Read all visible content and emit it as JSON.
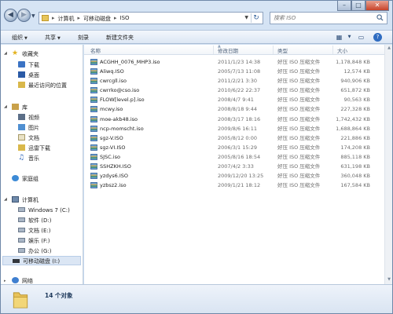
{
  "address": {
    "crumbs": [
      "计算机",
      "可移动磁盘",
      "ISO"
    ]
  },
  "search": {
    "placeholder": "搜索 ISO"
  },
  "toolbar": {
    "organize": "组织",
    "share": "共享",
    "burn": "刻录",
    "new_folder": "新建文件夹"
  },
  "sidebar": {
    "favorites": "收藏夹",
    "fav_items": [
      "下载",
      "桌面",
      "最近访问的位置"
    ],
    "libraries": "库",
    "lib_items": [
      "视频",
      "图片",
      "文档",
      "迅雷下载",
      "音乐"
    ],
    "homegroup": "家庭组",
    "computer": "计算机",
    "drives": [
      "Windows 7 (C:)",
      "软件 (D:)",
      "文档 (E:)",
      "娱乐 (F:)",
      "办公 (G:)",
      "可移动磁盘 (I:)"
    ],
    "network": "网络"
  },
  "columns": {
    "name": "名称",
    "date": "修改日期",
    "type": "类型",
    "size": "大小"
  },
  "files": [
    {
      "name": "ACGHH_0076_MHP3.iso",
      "date": "2011/1/23 14:38",
      "type": "好压 ISO 压缩文件",
      "size": "1,178,848 KB"
    },
    {
      "name": "Aliwq.ISO",
      "date": "2005/7/13 11:08",
      "type": "好压 ISO 压缩文件",
      "size": "12,574 KB"
    },
    {
      "name": "cwrcgll.iso",
      "date": "2011/2/21 3:30",
      "type": "好压 ISO 压缩文件",
      "size": "940,906 KB"
    },
    {
      "name": "cwrrko@cso.iso",
      "date": "2010/6/22 22:37",
      "type": "好压 ISO 压缩文件",
      "size": "651,872 KB"
    },
    {
      "name": "FLOW[level.p].iso",
      "date": "2008/4/7 9:41",
      "type": "好压 ISO 压缩文件",
      "size": "90,563 KB"
    },
    {
      "name": "mcwy.iso",
      "date": "2008/8/18 9:44",
      "type": "好压 ISO 压缩文件",
      "size": "227,328 KB"
    },
    {
      "name": "moe-akb48.iso",
      "date": "2008/3/17 18:16",
      "type": "好压 ISO 压缩文件",
      "size": "1,742,432 KB"
    },
    {
      "name": "ncp-momscht.iso",
      "date": "2009/8/6 16:11",
      "type": "好压 ISO 压缩文件",
      "size": "1,688,864 KB"
    },
    {
      "name": "sgz-V.ISO",
      "date": "2005/8/12 0:00",
      "type": "好压 ISO 压缩文件",
      "size": "221,886 KB"
    },
    {
      "name": "sgz-VI.ISO",
      "date": "2006/3/1 15:29",
      "type": "好压 ISO 压缩文件",
      "size": "174,208 KB"
    },
    {
      "name": "SJSC.iso",
      "date": "2005/8/16 18:54",
      "type": "好压 ISO 压缩文件",
      "size": "885,118 KB"
    },
    {
      "name": "SSHZKH.ISO",
      "date": "2007/4/2 3:33",
      "type": "好压 ISO 压缩文件",
      "size": "631,198 KB"
    },
    {
      "name": "yzdys6.ISO",
      "date": "2009/12/20 13:25",
      "type": "好压 ISO 压缩文件",
      "size": "360,048 KB"
    },
    {
      "name": "yzbsz2.iso",
      "date": "2009/1/21 18:12",
      "type": "好压 ISO 压缩文件",
      "size": "167,584 KB"
    }
  ],
  "status": {
    "count": "14 个对象"
  }
}
